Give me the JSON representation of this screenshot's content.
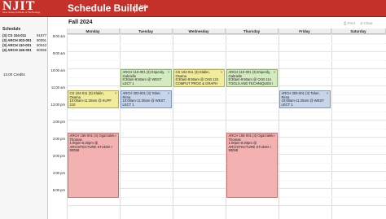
{
  "header": {
    "logo_text": "NJIT",
    "logo_subtext": "New Jersey Institute of Technology",
    "app_title": "Schedule Builder",
    "info_link": "Info"
  },
  "sidebar": {
    "title": "Schedule",
    "courses": [
      {
        "code": "(3) CS 104-011",
        "crn": "91877"
      },
      {
        "code": "(3) ARCH 303-001",
        "crn": "90091"
      },
      {
        "code": "(3) ARCH 110-001",
        "crn": "90043"
      },
      {
        "code": "(4) ARCH 155-001",
        "crn": "90058"
      }
    ],
    "credits": "13.00 Credits"
  },
  "toolbar": {
    "term": "Fall 2024",
    "print_label": "Print",
    "clear_label": "Clear"
  },
  "calendar": {
    "days": [
      "Monday",
      "Tuesday",
      "Wednesday",
      "Thursday",
      "Friday",
      "Saturday"
    ],
    "times": [
      "8:00 am",
      "9:00 am",
      "10:00 am",
      "11:00 am",
      "12:00 pm",
      "1:00 pm",
      "2:00 pm",
      "3:00 pm",
      "4:00 pm",
      "5:00 pm"
    ],
    "events": [
      {
        "id": "arch110-tue",
        "color": "green",
        "lines": [
          "ARCH 110-001 (3) Esperdy,",
          "Gabrielle",
          "8:30am-9:50am @ WEST",
          "LECT 1"
        ]
      },
      {
        "id": "cs104-wed",
        "color": "yellow",
        "lines": [
          "CS 104-011 (3) Elabin,",
          "Osama",
          "8:30am-9:50am @ CKB 124",
          "COMPUT PROG & GRAPH"
        ]
      },
      {
        "id": "arch110-thu",
        "color": "green",
        "lines": [
          "ARCH 110-001 (3) Esperdy,",
          "Gabrielle",
          "8:30am-9:50am @ CKB 114",
          "TOOLS AND TECHNIQUES I"
        ]
      },
      {
        "id": "cs104-mon",
        "color": "yellow",
        "lines": [
          "CS 104-011 (3) Elabin,",
          "Osama",
          "10:00am-11:20am @ KUPF",
          "210"
        ]
      },
      {
        "id": "arch303-tue",
        "color": "blue",
        "lines": [
          "ARCH 303-001 (3) Taher,",
          "Rima",
          "10:00am-11:20am @ WEST",
          "LECT 1"
        ]
      },
      {
        "id": "arch303-fri",
        "color": "blue",
        "lines": [
          "ARCH 303-001 (3) Taher,",
          "Rima",
          "10:00am-11:20am @ WEST",
          "LECT 1"
        ]
      },
      {
        "id": "arch155-mon",
        "color": "pink",
        "lines": [
          "ARCH 155-001 (4) Ogorzalek,",
          "Thomas",
          "1:00pm-5:20pm @",
          "ARCHITECTURE STUDIO I",
          "90058"
        ]
      },
      {
        "id": "arch155-thu",
        "color": "pink",
        "lines": [
          "ARCH 155-001 (4) Ogorzalek,",
          "Thomas",
          "1:00pm-5:20pm @",
          "ARCHITECTURE STUDIO I",
          "90058"
        ]
      }
    ]
  }
}
